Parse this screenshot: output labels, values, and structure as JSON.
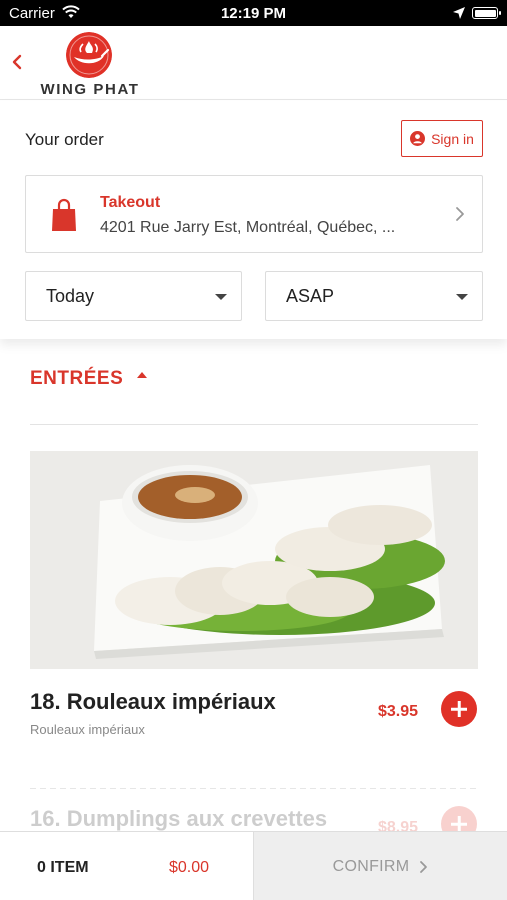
{
  "status_bar": {
    "carrier": "Carrier",
    "time": "12:19 PM",
    "wifi_icon": "wifi-icon",
    "location_icon": "location-arrow-icon",
    "battery_icon": "battery-icon"
  },
  "header": {
    "back_icon": "chevron-left-icon",
    "brand": "WING PHAT",
    "brand_color": "#e03127"
  },
  "order": {
    "heading": "Your order",
    "sign_in_label": "Sign in",
    "sign_in_icon": "user-circle-icon",
    "mode": "Takeout",
    "mode_icon": "shopping-bag-icon",
    "address": "4201 Rue Jarry Est, Montréal, Québec, ...",
    "day": "Today",
    "time": "ASAP"
  },
  "menu": {
    "section_title": "ENTRÉES",
    "items": [
      {
        "name": "18. Rouleaux impériaux",
        "description": "Rouleaux impériaux",
        "price": "$3.95"
      },
      {
        "name": "16. Dumplings aux crevettes",
        "price": "$8.95"
      }
    ]
  },
  "cart": {
    "count": "0 ITEM",
    "total": "$0.00",
    "confirm_label": "CONFIRM"
  },
  "colors": {
    "accent": "#d9362b",
    "muted": "#999999"
  }
}
